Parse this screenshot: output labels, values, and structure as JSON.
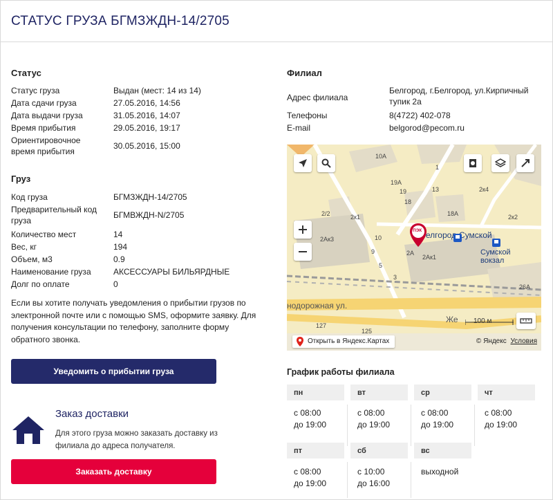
{
  "page": {
    "title": "СТАТУС ГРУЗА БГМЗЖДН-14/2705"
  },
  "status": {
    "title": "Статус",
    "rows": [
      {
        "label": "Статус груза",
        "value": "Выдан (мест: 14 из 14)"
      },
      {
        "label": "Дата сдачи груза",
        "value": "27.05.2016, 14:56"
      },
      {
        "label": "Дата выдачи груза",
        "value": "31.05.2016, 14:07"
      },
      {
        "label": "Время прибытия",
        "value": "29.05.2016, 19:17"
      },
      {
        "label": "Ориентировочное время прибытия",
        "value": "30.05.2016, 15:00"
      }
    ]
  },
  "cargo": {
    "title": "Груз",
    "rows": [
      {
        "label": "Код груза",
        "value": "БГМЗЖДН-14/2705"
      },
      {
        "label": "Предварительный код груза",
        "value": "БГМВЖДН-N/2705"
      },
      {
        "label": "Количество мест",
        "value": "14"
      },
      {
        "label": "Вес, кг",
        "value": "194"
      },
      {
        "label": "Объем, м3",
        "value": "0.9"
      },
      {
        "label": "Наименование груза",
        "value": "АКСЕССУАРЫ БИЛЬЯРДНЫЕ"
      },
      {
        "label": "Долг по оплате",
        "value": "0"
      }
    ]
  },
  "note": "Если вы хотите получать уведомления о прибытии грузов по электронной почте или с помощью SMS, оформите заявку. Для получения консультации по телефону, заполните форму обратного звонка.",
  "notify_button": "Уведомить о прибытии груза",
  "delivery": {
    "title": "Заказ доставки",
    "text": "Для этого груза можно заказать доставку из филиала до адреса получателя.",
    "button": "Заказать доставку"
  },
  "branch": {
    "title": "Филиал",
    "address_label": "Адрес филиала",
    "address_value": "Белгород, г.Белгород, ул.Кирпичный тупик 2а",
    "phone_label": "Телефоны",
    "phone_value": "8(4722) 402-078",
    "email_label": "E-mail",
    "email_value": "belgorod@pecom.ru"
  },
  "map": {
    "labels": {
      "b10a": "10А",
      "b19a": "19А",
      "b19": "19",
      "b1": "1",
      "b13": "13",
      "b2x4": "2к4",
      "b18a": "18А",
      "b18": "18",
      "b2x2": "2/2",
      "b2x1": "2к1",
      "b2x2b": "2к2",
      "b2ak3": "2Ак3",
      "b10": "10",
      "b9": "9",
      "b5": "5",
      "b3": "3",
      "b2a": "2А",
      "b2ak1": "2Ак1",
      "b26a": "26А",
      "b127": "127",
      "b125": "125",
      "station1": "Белгород-Сумской",
      "station2": "Сумской\nвокзал",
      "street1": "нодорожная ул.",
      "street2": "Же",
      "marker": "ПЭК"
    },
    "scale": "100 м",
    "open_link": "Открыть в Яндекс.Картах",
    "copyright": "© Яндекс",
    "terms": "Условия"
  },
  "schedule": {
    "title": "График работы филиала",
    "days": [
      {
        "day": "пн",
        "from": "с 08:00",
        "to": "до 19:00"
      },
      {
        "day": "вт",
        "from": "с 08:00",
        "to": "до 19:00"
      },
      {
        "day": "ср",
        "from": "с 08:00",
        "to": "до 19:00"
      },
      {
        "day": "чт",
        "from": "с 08:00",
        "to": "до 19:00"
      },
      {
        "day": "пт",
        "from": "с 08:00",
        "to": "до 19:00"
      },
      {
        "day": "сб",
        "from": "с 10:00",
        "to": "до 16:00"
      },
      {
        "day": "вс",
        "from": "выходной",
        "to": ""
      }
    ]
  }
}
